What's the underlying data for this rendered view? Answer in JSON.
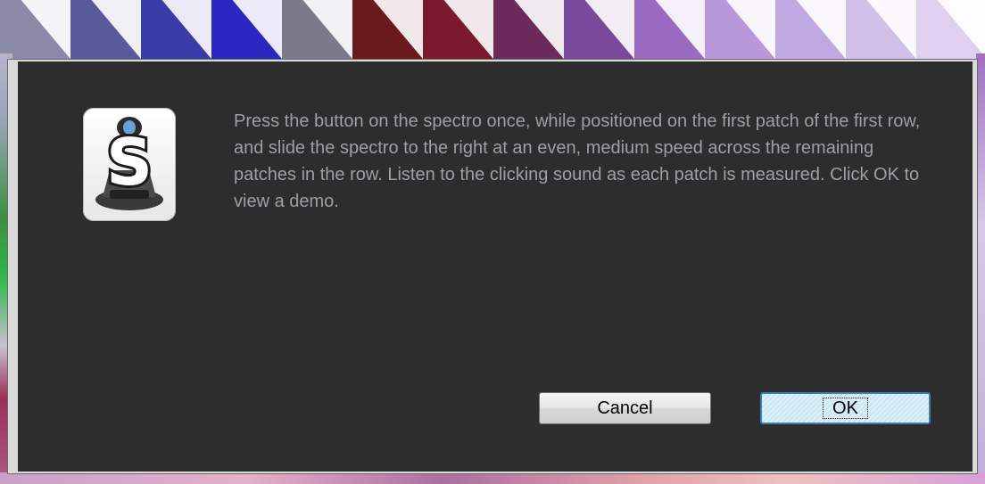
{
  "background": {
    "patch_colors": [
      "#8a8aa8",
      "#5a5a9a",
      "#3a3aa8",
      "#2a28c0",
      "#7a7a8a",
      "#6a1a1a",
      "#7a1a2e",
      "#6a2a5a",
      "#7a4a9a",
      "#9a6ac0",
      "#b898d8",
      "#c0a8e0",
      "#d0c0e8",
      "#e0d0f0"
    ]
  },
  "icon": {
    "name": "spectro-app-icon",
    "letter": "S"
  },
  "dialog": {
    "message": "Press the button on the spectro once, while positioned on the first patch of the first row, and slide the spectro to the right at an even, medium speed across the remaining patches in the row. Listen to the clicking sound as each patch is measured. Click OK to view a demo.",
    "cancel_label": "Cancel",
    "ok_label": "OK"
  },
  "colors": {
    "dialog_background": "#2d2d2d",
    "message_text": "#9aa0a6",
    "ok_border": "#3c7fb1"
  }
}
